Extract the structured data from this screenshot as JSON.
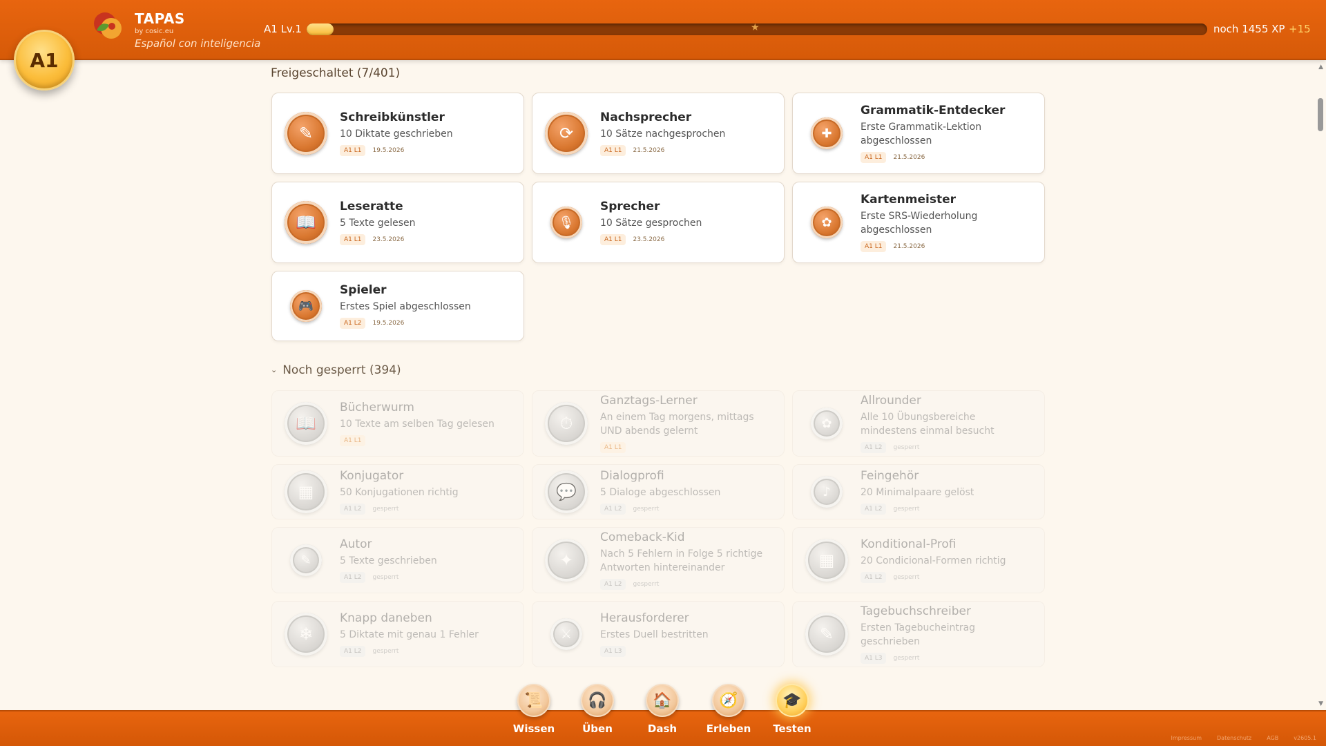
{
  "header": {
    "level_badge": "A1",
    "brand": {
      "title": "TAPAS",
      "subtitle": "by cosic.eu",
      "tagline": "Español con inteligencia"
    },
    "xp": {
      "level_label": "A1 Lv.1",
      "progress": 0.03,
      "remaining": "noch 1455 XP",
      "gain": "+15"
    }
  },
  "unlocked": {
    "title": "Freigeschaltet (7/401)",
    "items": [
      {
        "title": "Schreibkünstler",
        "desc": "10 Diktate geschrieben",
        "tag": "A1 L1",
        "date": "19.5.2026",
        "icon": "✎",
        "medal": "bronze"
      },
      {
        "title": "Nachsprecher",
        "desc": "10 Sätze nachgesprochen",
        "tag": "A1 L1",
        "date": "21.5.2026",
        "icon": "⟳",
        "medal": "bronze"
      },
      {
        "title": "Grammatik-Entdecker",
        "desc": "Erste Grammatik-Lektion abgeschlossen",
        "tag": "A1 L1",
        "date": "21.5.2026",
        "icon": "✚",
        "medal": "bronze",
        "small": true
      },
      {
        "title": "Leseratte",
        "desc": "5 Texte gelesen",
        "tag": "A1 L1",
        "date": "23.5.2026",
        "icon": "📖",
        "medal": "bronze"
      },
      {
        "title": "Sprecher",
        "desc": "10 Sätze gesprochen",
        "tag": "A1 L1",
        "date": "23.5.2026",
        "icon": "🎙",
        "medal": "bronze",
        "small": true
      },
      {
        "title": "Kartenmeister",
        "desc": "Erste SRS-Wiederholung abgeschlossen",
        "tag": "A1 L1",
        "date": "21.5.2026",
        "icon": "✿",
        "medal": "bronze",
        "small": true
      },
      {
        "title": "Spieler",
        "desc": "Erstes Spiel abgeschlossen",
        "tag": "A1 L2",
        "date": "19.5.2026",
        "icon": "🎮",
        "medal": "bronze",
        "small": true,
        "short": true
      }
    ]
  },
  "locked": {
    "title": "Noch gesperrt (394)",
    "items": [
      {
        "title": "Bücherwurm",
        "desc": "10 Texte am selben Tag gelesen",
        "tag": "A1 L1",
        "date": "",
        "icon": "📖",
        "medal": "grey",
        "tag_active": true
      },
      {
        "title": "Ganztags-Lerner",
        "desc": "An einem Tag morgens, mittags UND abends gelernt",
        "tag": "A1 L1",
        "date": "",
        "icon": "⏱",
        "medal": "grey",
        "tag_active": true
      },
      {
        "title": "Allrounder",
        "desc": "Alle 10 Übungsbereiche mindestens einmal besucht",
        "tag": "A1 L2",
        "date": "gesperrt",
        "icon": "✿",
        "medal": "grey",
        "small": true
      },
      {
        "title": "Konjugator",
        "desc": "50 Konjugationen richtig",
        "tag": "A1 L2",
        "date": "gesperrt",
        "icon": "▦",
        "medal": "grey"
      },
      {
        "title": "Dialogprofi",
        "desc": "5 Dialoge abgeschlossen",
        "tag": "A1 L2",
        "date": "gesperrt",
        "icon": "💬",
        "medal": "grey"
      },
      {
        "title": "Feingehör",
        "desc": "20 Minimalpaare gelöst",
        "tag": "A1 L2",
        "date": "gesperrt",
        "icon": "♪",
        "medal": "grey",
        "small": true
      },
      {
        "title": "Autor",
        "desc": "5 Texte geschrieben",
        "tag": "A1 L2",
        "date": "gesperrt",
        "icon": "✎",
        "medal": "grey",
        "small": true
      },
      {
        "title": "Comeback-Kid",
        "desc": "Nach 5 Fehlern in Folge 5 richtige Antworten hintereinander",
        "tag": "A1 L2",
        "date": "gesperrt",
        "icon": "✦",
        "medal": "grey"
      },
      {
        "title": "Konditional-Profi",
        "desc": "20 Condicional-Formen richtig",
        "tag": "A1 L2",
        "date": "gesperrt",
        "icon": "▦",
        "medal": "grey"
      },
      {
        "title": "Knapp daneben",
        "desc": "5 Diktate mit genau 1 Fehler",
        "tag": "A1 L2",
        "date": "gesperrt",
        "icon": "❄",
        "medal": "grey"
      },
      {
        "title": "Herausforderer",
        "desc": "Erstes Duell bestritten",
        "tag": "A1 L3",
        "date": "",
        "icon": "⚔",
        "medal": "grey",
        "small": true
      },
      {
        "title": "Tagebuchschreiber",
        "desc": "Ersten Tagebucheintrag geschrieben",
        "tag": "A1 L3",
        "date": "gesperrt",
        "icon": "✎",
        "medal": "grey"
      }
    ]
  },
  "nav": [
    {
      "label": "Wissen",
      "icon": "📜",
      "name": "wissen",
      "active": false
    },
    {
      "label": "Üben",
      "icon": "🎧",
      "name": "ueben",
      "active": false
    },
    {
      "label": "Dash",
      "icon": "🏠",
      "name": "dash",
      "active": false
    },
    {
      "label": "Erleben",
      "icon": "🧭",
      "name": "erleben",
      "active": false
    },
    {
      "label": "Testen",
      "icon": "🎓",
      "name": "testen",
      "active": true
    }
  ],
  "footer": [
    "Impressum",
    "Datenschutz",
    "AGB",
    "v2605.1"
  ]
}
